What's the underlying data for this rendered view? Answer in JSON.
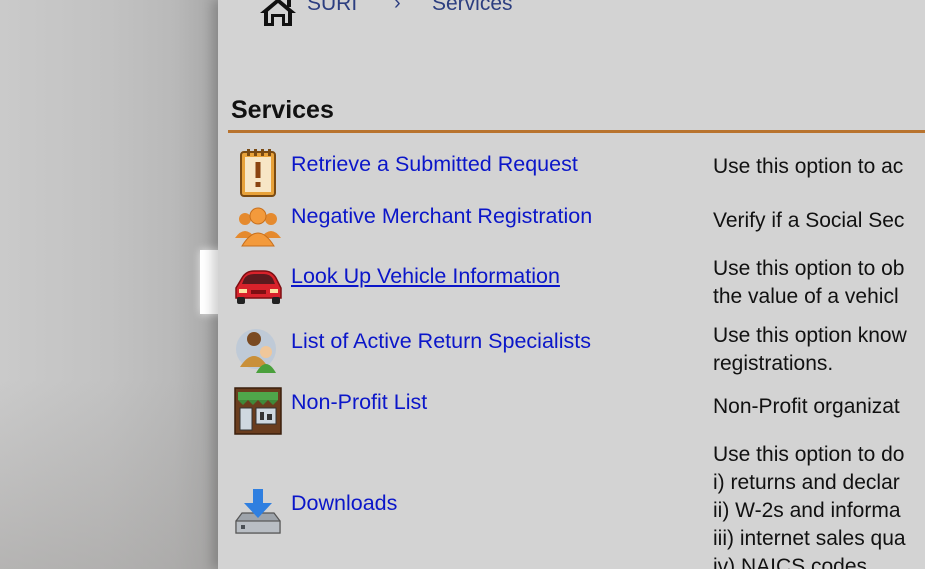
{
  "breadcrumb": {
    "home_icon": "home-icon",
    "items": [
      "SURI",
      "Services"
    ],
    "separator": "›"
  },
  "page": {
    "title": "Services"
  },
  "services": [
    {
      "icon": "clipboard-exclamation-icon",
      "label": "Retrieve a Submitted Request",
      "description": [
        "Use this option to ac"
      ]
    },
    {
      "icon": "group-people-icon",
      "label": "Negative Merchant Registration",
      "description": [
        "Verify if a Social Sec"
      ]
    },
    {
      "icon": "red-car-icon",
      "label": "Look Up Vehicle Information",
      "description": [
        "Use this option to ob",
        "the value of a vehicl"
      ],
      "highlighted": true
    },
    {
      "icon": "specialists-icon",
      "label": "List of Active Return Specialists",
      "description": [
        "Use this option know",
        "registrations."
      ]
    },
    {
      "icon": "storefront-icon",
      "label": "Non-Profit List",
      "description": [
        "Non-Profit organizat"
      ]
    },
    {
      "icon": "download-tray-icon",
      "label": "Downloads",
      "description": [
        "Use this option to do",
        "i) returns and declar",
        "ii) W-2s and informa",
        "iii) internet sales qua",
        "iv) NAICS codes"
      ]
    }
  ],
  "colors": {
    "link": "#0b16c9",
    "breadcrumb": "#2c3e80",
    "rule": "#b8732e",
    "panel": "#d3d3d3"
  }
}
